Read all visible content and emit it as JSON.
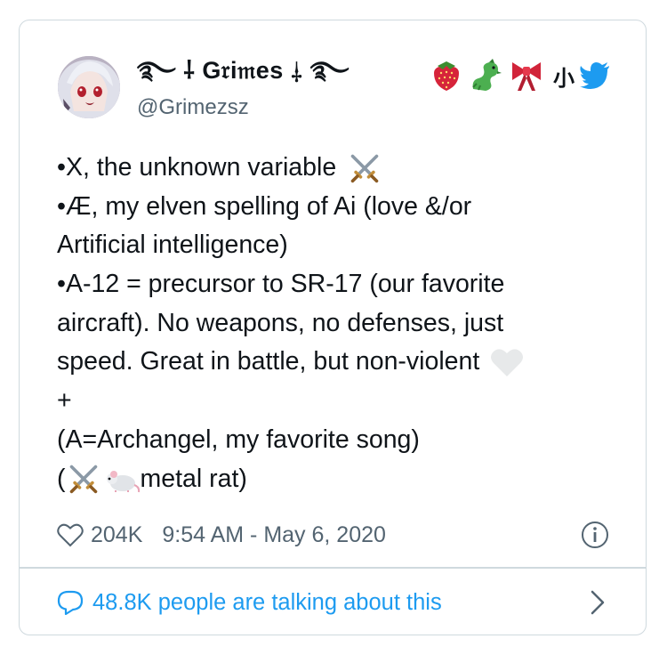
{
  "user": {
    "display_name": "࿐ ⸸ G𝔯i𝔪es ⸸ ࿐",
    "handle": "@Grimezsz",
    "name_emojis": [
      "strawberry-icon",
      "dragon-icon",
      "ribbon-icon"
    ],
    "name_suffix": "小",
    "verified_badge": "bird-icon"
  },
  "tweet": {
    "lines": [
      {
        "text": "•X, the unknown variable",
        "icons": [
          "crossed-swords-icon"
        ]
      },
      {
        "text": "•Æ, my elven spelling of Ai (love &/or",
        "icons": []
      },
      {
        "text": "Artificial intelligence)",
        "icons": []
      },
      {
        "text": "•A-12 = precursor to SR-17 (our favorite",
        "icons": []
      },
      {
        "text": "aircraft).  No weapons, no defenses, just",
        "icons": []
      },
      {
        "text": "speed.  Great in battle, but non-violent",
        "icons": [
          "white-heart-icon"
        ]
      },
      {
        "text": "+",
        "icons": []
      },
      {
        "text": "(A=Archangel, my favorite song)",
        "icons": []
      },
      {
        "text_before": "(",
        "icons": [
          "crossed-swords-icon",
          "rat-icon"
        ],
        "text_after": " metal rat)"
      }
    ]
  },
  "meta": {
    "likes": "204K",
    "timestamp": "9:54 AM - May 6, 2020",
    "like_icon": "heart-outline-icon",
    "info_icon": "info-icon"
  },
  "footer": {
    "talking": "48.8K people are talking about this",
    "chevron_icon": "chevron-right-icon"
  },
  "colors": {
    "accent": "#1d9bf0",
    "text": "#0f1419",
    "muted": "#536471",
    "border": "#cfd9de"
  }
}
